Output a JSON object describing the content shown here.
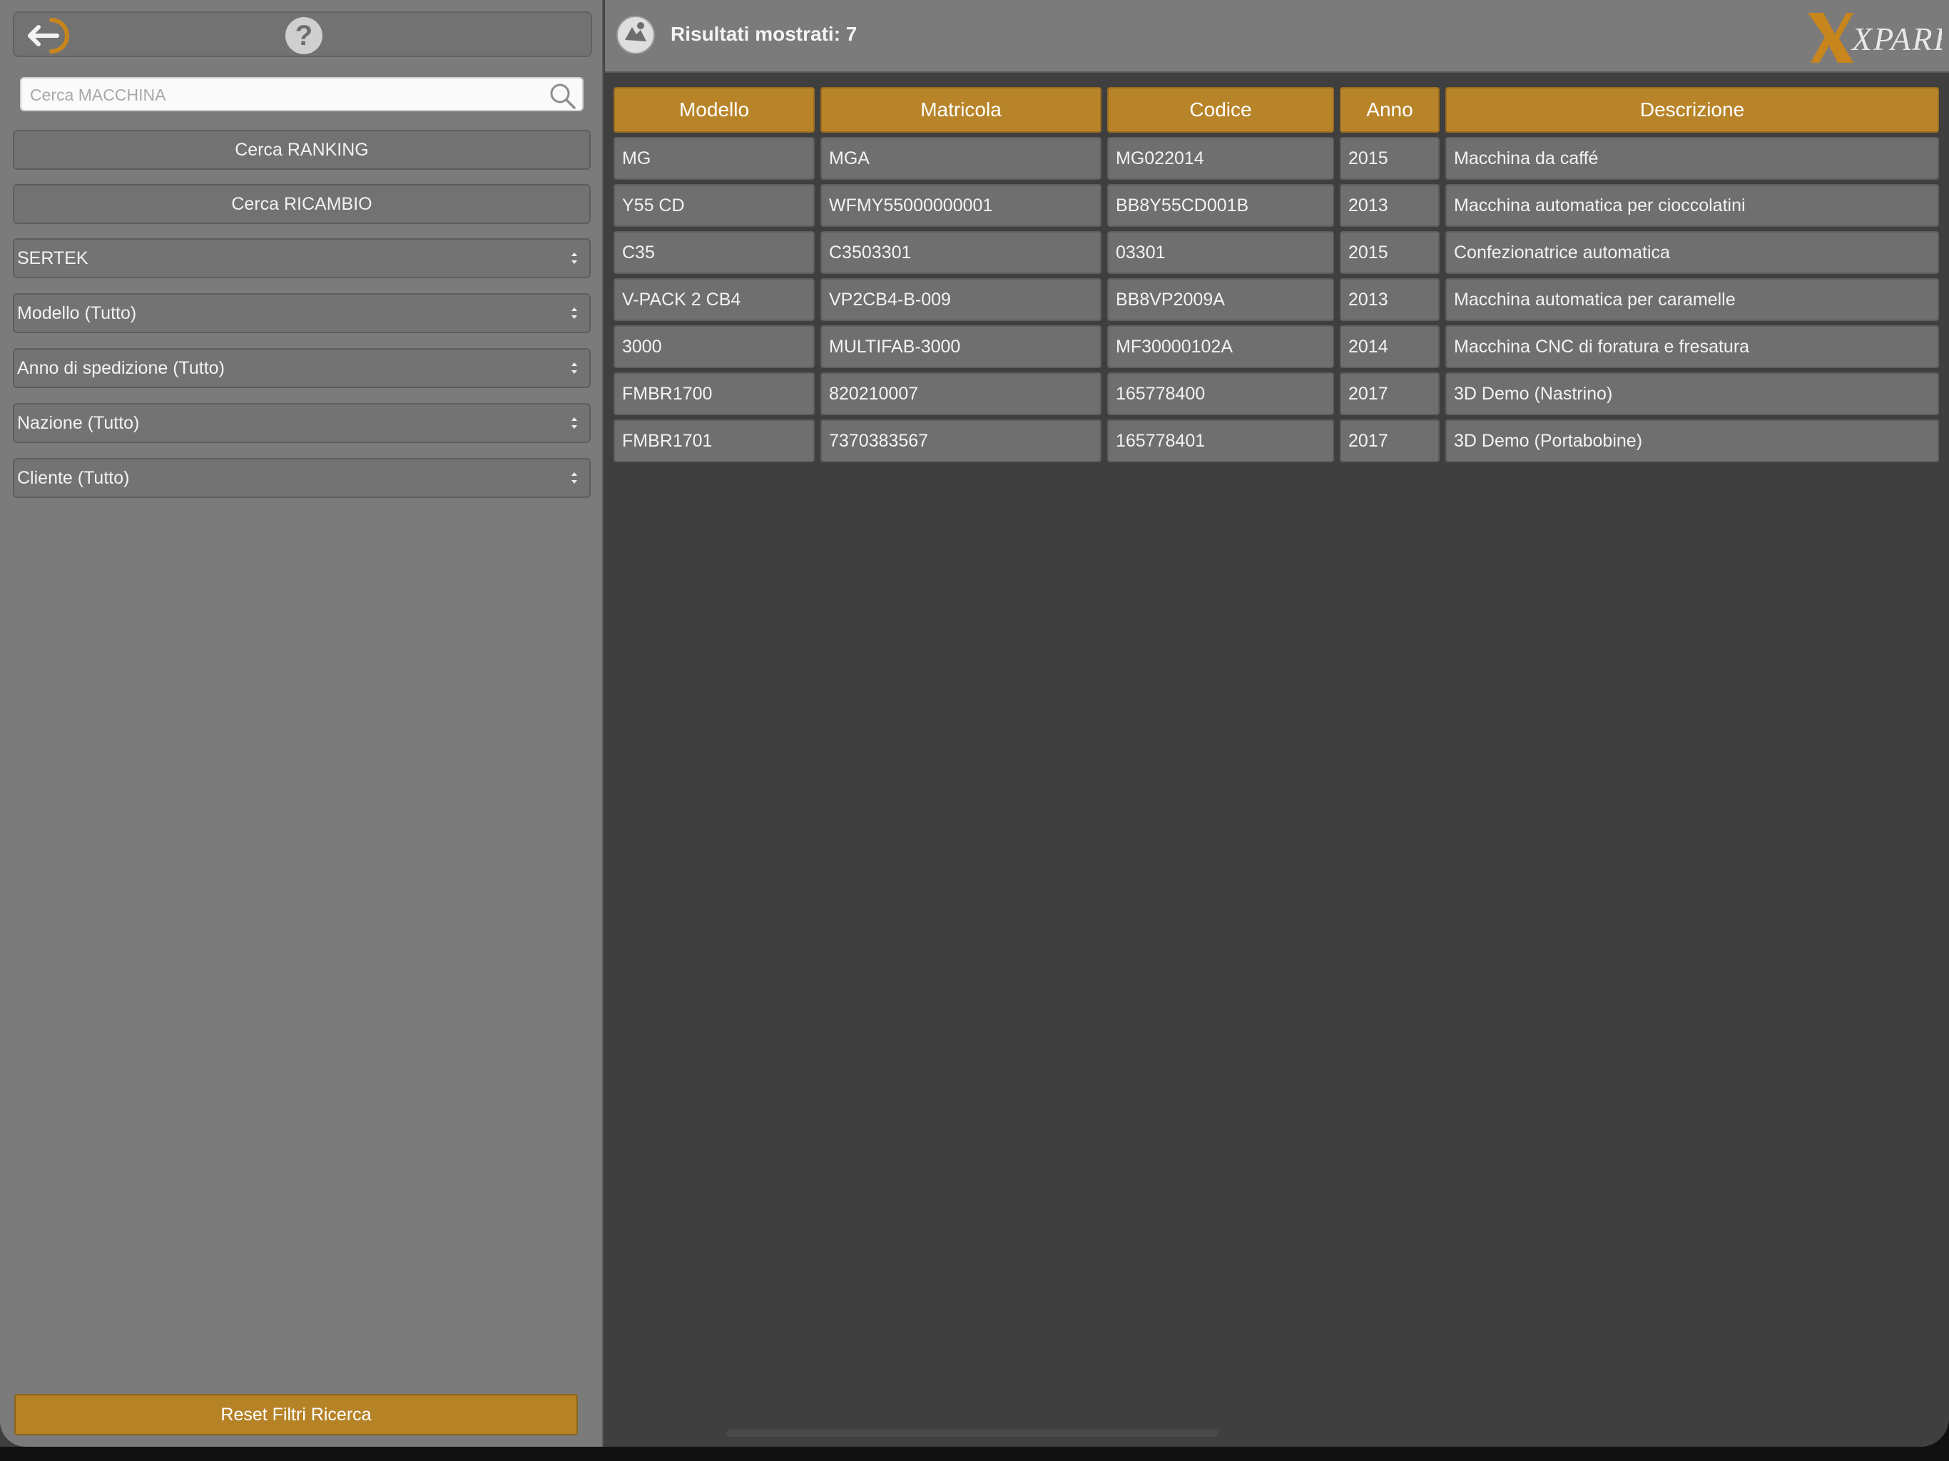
{
  "sidebar": {
    "search_placeholder": "Cerca MACCHINA",
    "help_label": "?",
    "buttons": {
      "ranking": "Cerca RANKING",
      "ricambio": "Cerca RICAMBIO"
    },
    "filters": [
      "SERTEK",
      "Modello (Tutto)",
      "Anno di spedizione (Tutto)",
      "Nazione (Tutto)",
      "Cliente (Tutto)"
    ],
    "reset_label": "Reset Filtri Ricerca"
  },
  "header": {
    "results_text": "Risultati mostrati: 7",
    "logo_text": "XPARE"
  },
  "colors": {
    "accent": "#b8842a",
    "sidebar_bg": "#7b7b7b",
    "main_bg": "#3f3f3f",
    "cell_bg": "#6f6f6f"
  },
  "table": {
    "columns": [
      "Modello",
      "Matricola",
      "Codice",
      "Anno",
      "Descrizione"
    ],
    "rows": [
      [
        "MG",
        "MGA",
        "MG022014",
        "2015",
        "Macchina da caffé"
      ],
      [
        "Y55 CD",
        "WFMY55000000001",
        "BB8Y55CD001B",
        "2013",
        "Macchina automatica per cioccolatini"
      ],
      [
        "C35",
        "C3503301",
        "03301",
        "2015",
        "Confezionatrice automatica"
      ],
      [
        "V-PACK 2 CB4",
        "VP2CB4-B-009",
        "BB8VP2009A",
        "2013",
        "Macchina automatica per caramelle"
      ],
      [
        "3000",
        "MULTIFAB-3000",
        "MF30000102A",
        "2014",
        "Macchina CNC di foratura e fresatura"
      ],
      [
        "FMBR1700",
        "820210007",
        "165778400",
        "2017",
        "3D Demo (Nastrino)"
      ],
      [
        "FMBR1701",
        "7370383567",
        "165778401",
        "2017",
        "3D Demo (Portabobine)"
      ]
    ]
  }
}
